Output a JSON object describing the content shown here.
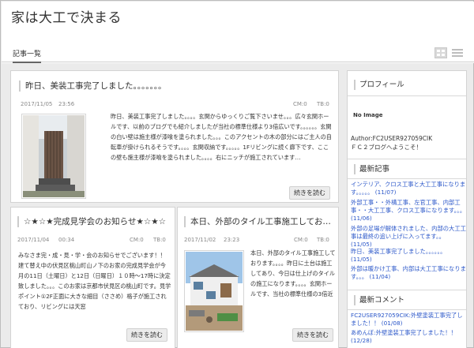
{
  "site": {
    "title": "家は大工で決まる"
  },
  "nav": {
    "tab_label": "記事一覧"
  },
  "articles": [
    {
      "title": "昨日、美装工事完了しました。。。。。。。",
      "date": "2017/11/05",
      "time": "23:56",
      "comments": "CM:0",
      "trackbacks": "TB:0",
      "body": "昨日、美装工事完了しました。。。。玄関からゆっくりご覧下さいませ。。。広々玄関ホールです、以前のブログでも紹介しましたが当社の標準仕様より3倍広いです。。。。。。玄関の白い壁は施主様が漆喰を塗られました。。。このアクセントの木の部分にはご主人の自転車が掛けられるそうです。。。。玄関収納です。。。。。1Fリビングに続く廊下です、ここの壁も施主様が漆喰を塗られました。。。。右にニッチが施工されています…",
      "more": "続きを読む"
    },
    {
      "title": "☆★☆★完成見学会のお知らせ★☆★☆",
      "date": "2017/11/04",
      "time": "00:34",
      "comments": "CM:0",
      "trackbacks": "TB:0",
      "body": "みなさま完・成・見・学・会のお知らせでございます！！ 建て替え中の伏見区桃山町山ノ下のお家の完成見学会が今月の11日（土曜日）と12日（日曜日）１０時～17時に決定致しました。。。このお家は京都市伏見区の桃山町です。見学ポイント①2F正面に大きな細目（ささめ）格子が施工されており、リビングには天窓",
      "more": "続きを読む"
    },
    {
      "title": "本日、外部のタイル工事施工しております…",
      "date": "2017/11/02",
      "time": "23:23",
      "comments": "CM:0",
      "trackbacks": "TB:0",
      "body": "本日、外部のタイル工事施工しております。。。。昨日に土台は施工してあり、今日は仕上げのタイルの施工になります。。。。玄関ホールです、当社の標準仕様の3倍近",
      "more": "続きを読む"
    }
  ],
  "sidebar": {
    "profile_heading": "プロフィール",
    "no_image": "No Image",
    "author": "Author:FC2USER927059CIK\nＦＣ２ブログへようこそ！",
    "recent_heading": "最新記事",
    "recent_posts": [
      "インテリア、クロス工事と大工工事になります。。。。。 (11/07)",
      "外部工事・・外構工事、左官工事、内部工事・・大工工事、クロス工事になります。。。 (11/06)",
      "外部の足場が解体されました、内部の大工工事は最終の追い上げに入ってます。。 (11/05)",
      "昨日、美装工事完了しました。。。。。。 (11/05)",
      "外部は暖かけ工事、内部は大工工事になります。。。 (11/04)"
    ],
    "comments_heading": "最新コメント",
    "recent_comments": [
      "FC2USER927059CIK:外壁塗装工事完了しました！！ (01/08)",
      "あめんぼ:外壁塗装工事完了しました！！ (12/28)"
    ]
  }
}
